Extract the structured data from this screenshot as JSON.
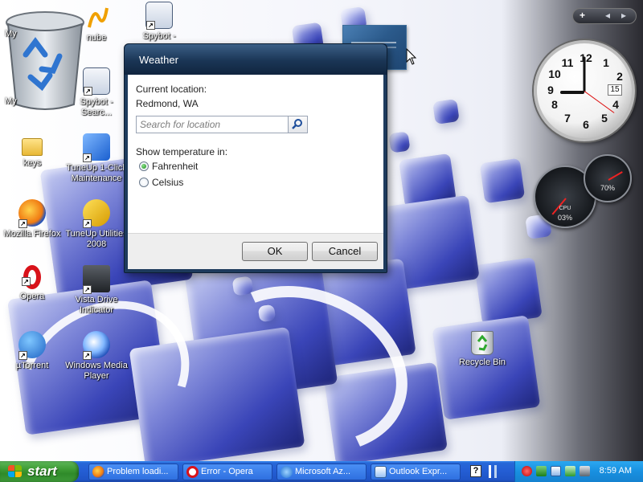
{
  "desktop": {
    "icons": [
      {
        "label": "My",
        "name": "my-documents-icon"
      },
      {
        "label": "nube",
        "name": "nube-icon"
      },
      {
        "label": "Spybot -",
        "name": "spybot-icon"
      },
      {
        "label": "My",
        "name": "recycle-big-icon"
      },
      {
        "label": "Spybot - Searc...",
        "name": "spybot-search-icon"
      },
      {
        "label": "keys",
        "name": "keys-folder-icon"
      },
      {
        "label": "TuneUp 1-Click Maintenance",
        "name": "tuneup-maintenance-icon"
      },
      {
        "label": "Mozilla Firefox",
        "name": "firefox-icon"
      },
      {
        "label": "TuneUp Utilities 2008",
        "name": "tuneup-utilities-icon"
      },
      {
        "label": "Opera",
        "name": "opera-icon"
      },
      {
        "label": "Vista Drive Indicator",
        "name": "vista-drive-indicator-icon"
      },
      {
        "label": "µTorrent",
        "name": "utorrent-icon"
      },
      {
        "label": "Windows Media Player",
        "name": "windows-media-player-icon"
      },
      {
        "label": "Recycle Bin",
        "name": "recycle-bin-icon"
      }
    ]
  },
  "sidebar": {
    "add_label": "+",
    "prev_label": "◂",
    "next_label": "▸",
    "clock": {
      "numbers": [
        "12",
        "1",
        "2",
        "3",
        "4",
        "5",
        "6",
        "7",
        "8",
        "9",
        "10",
        "11"
      ],
      "date": "15"
    },
    "gauges": {
      "cpu_label": "CPU",
      "cpu_value": "03%",
      "mem_value": "70%"
    }
  },
  "dialog": {
    "title": "Weather",
    "current_location_label": "Current location:",
    "current_location_value": "Redmond, WA",
    "search_placeholder": "Search for location",
    "show_temperature_label": "Show temperature in:",
    "option_fahrenheit": "Fahrenheit",
    "option_celsius": "Celsius",
    "selected_option": "Fahrenheit",
    "ok_label": "OK",
    "cancel_label": "Cancel"
  },
  "taskbar": {
    "start_label": "start",
    "tasks": [
      {
        "label": "Problem loadi...",
        "icon": "firefox-icon"
      },
      {
        "label": "Error - Opera",
        "icon": "opera-icon"
      },
      {
        "label": "Microsoft Az...",
        "icon": "ie-icon"
      },
      {
        "label": "Outlook Expr...",
        "icon": "outlook-express-icon"
      }
    ],
    "clock": "8:59 AM"
  }
}
